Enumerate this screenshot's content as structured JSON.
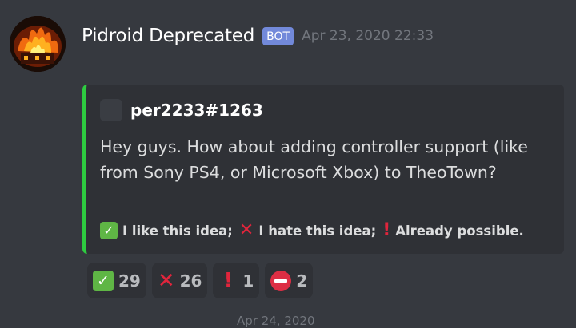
{
  "message": {
    "author": "Pidroid Deprecated",
    "bot_tag": "BOT",
    "timestamp": "Apr 23, 2020 22:33"
  },
  "embed": {
    "accent_color": "#2ecc40",
    "author_name": "per2233#1263",
    "description": "Hey guys. How about adding controller support (like from Sony PS4, or Microsoft Xbox) to TheoTown?",
    "footer": {
      "like_emoji": "white-check-mark",
      "like_text": "I like this idea;",
      "hate_emoji": "cross-mark",
      "hate_text": "I hate this idea;",
      "possible_emoji": "exclamation-mark",
      "possible_text": "Already possible."
    }
  },
  "reactions": [
    {
      "emoji": "white-check-mark",
      "count": "29"
    },
    {
      "emoji": "cross-mark",
      "count": "26"
    },
    {
      "emoji": "exclamation-mark",
      "count": "1"
    },
    {
      "emoji": "no-entry",
      "count": "2"
    }
  ],
  "date_divider": "Apr 24, 2020",
  "colors": {
    "background": "#36393f",
    "embed_background": "#2f3136",
    "bot_tag": "#7289da",
    "timestamp": "#72767d"
  }
}
